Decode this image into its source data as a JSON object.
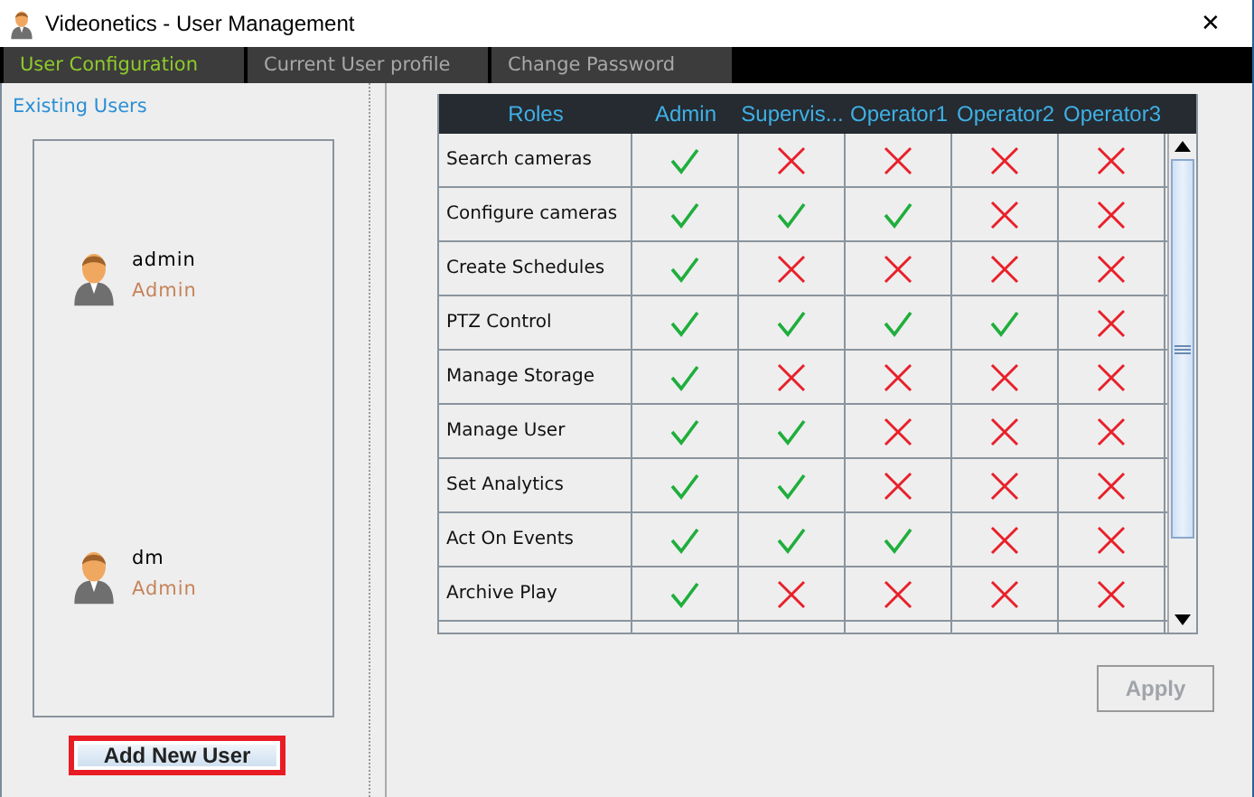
{
  "window": {
    "title": "Videonetics - User Management",
    "close": "✕"
  },
  "tabs": [
    {
      "label": "User Configuration",
      "selected": true
    },
    {
      "label": "Current User profile",
      "selected": false
    },
    {
      "label": "Change Password",
      "selected": false
    }
  ],
  "users_panel": {
    "title": "Existing Users",
    "users": [
      {
        "name": "admin",
        "role": "Admin"
      },
      {
        "name": "dm",
        "role": "Admin"
      }
    ],
    "add_button": {
      "label": "Add New User",
      "highlighted": true
    }
  },
  "table": {
    "columns": [
      "Roles",
      "Admin",
      "Supervis...",
      "Operator1",
      "Operator2",
      "Operator3"
    ],
    "rows": [
      {
        "role": "Search cameras",
        "allowed": [
          true,
          false,
          false,
          false,
          false
        ]
      },
      {
        "role": "Configure cameras",
        "allowed": [
          true,
          true,
          true,
          false,
          false
        ]
      },
      {
        "role": "Create Schedules",
        "allowed": [
          true,
          false,
          false,
          false,
          false
        ]
      },
      {
        "role": "PTZ Control",
        "allowed": [
          true,
          true,
          true,
          true,
          false
        ]
      },
      {
        "role": "Manage Storage",
        "allowed": [
          true,
          false,
          false,
          false,
          false
        ]
      },
      {
        "role": "Manage User",
        "allowed": [
          true,
          true,
          false,
          false,
          false
        ]
      },
      {
        "role": "Set Analytics",
        "allowed": [
          true,
          true,
          false,
          false,
          false
        ]
      },
      {
        "role": "Act On Events",
        "allowed": [
          true,
          true,
          true,
          false,
          false
        ]
      },
      {
        "role": "Archive Play",
        "allowed": [
          true,
          false,
          false,
          false,
          false
        ]
      }
    ]
  },
  "apply_button": {
    "label": "Apply",
    "disabled": true
  }
}
